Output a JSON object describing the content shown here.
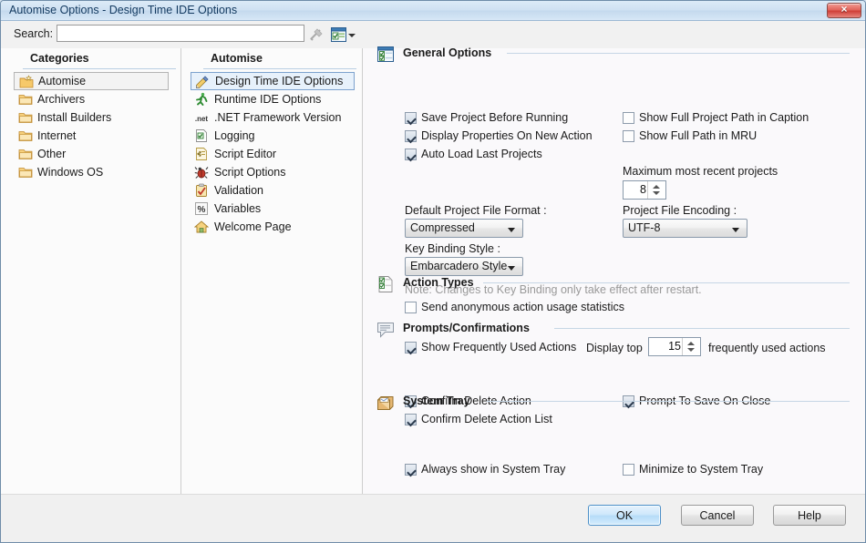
{
  "window": {
    "title": "Automise Options -  Design Time IDE Options",
    "close_label": "×",
    "accent_color": "#7da2ce",
    "titlebar_color": "#cfe1f2",
    "close_color": "#cf3f38"
  },
  "search": {
    "label": "Search:",
    "value": "",
    "placeholder": "",
    "clear_icon": "clear-search-icon",
    "options_icon": "search-options-icon",
    "dropdown_icon": "chevron-down-icon"
  },
  "categories": {
    "header": "Categories",
    "items": [
      {
        "label": "Automise",
        "icon": "folder-star-icon",
        "selected": true
      },
      {
        "label": "Archivers",
        "icon": "folder-icon",
        "selected": false
      },
      {
        "label": "Install Builders",
        "icon": "folder-icon",
        "selected": false
      },
      {
        "label": "Internet",
        "icon": "folder-icon",
        "selected": false
      },
      {
        "label": "Other",
        "icon": "folder-icon",
        "selected": false
      },
      {
        "label": "Windows OS",
        "icon": "folder-icon",
        "selected": false
      }
    ]
  },
  "pages": {
    "header": "Automise",
    "items": [
      {
        "label": "Design Time IDE Options",
        "icon": "pencil-ruler-icon",
        "selected": true
      },
      {
        "label": "Runtime IDE Options",
        "icon": "runner-icon",
        "selected": false
      },
      {
        "label": ".NET Framework Version",
        "icon": "dotnet-icon",
        "selected": false
      },
      {
        "label": "Logging",
        "icon": "log-document-icon",
        "selected": false
      },
      {
        "label": "Script Editor",
        "icon": "script-document-icon",
        "selected": false
      },
      {
        "label": "Script Options",
        "icon": "bug-icon",
        "selected": false
      },
      {
        "label": "Validation",
        "icon": "clipboard-check-icon",
        "selected": false
      },
      {
        "label": "Variables",
        "icon": "percent-icon",
        "selected": false
      },
      {
        "label": "Welcome Page",
        "icon": "home-icon",
        "selected": false
      }
    ]
  },
  "general_options": {
    "title": "General Options",
    "icon": "checklist-window-icon",
    "checkboxes_left": [
      {
        "label": "Save Project Before Running",
        "checked": true
      },
      {
        "label": "Display Properties On New Action",
        "checked": true
      },
      {
        "label": "Auto Load Last Projects",
        "checked": true
      }
    ],
    "checkboxes_right": [
      {
        "label": "Show Full Project Path in Caption",
        "checked": false
      },
      {
        "label": "Show Full Path in MRU",
        "checked": false
      }
    ],
    "max_recent_label": "Maximum most recent projects",
    "max_recent_value": "8",
    "default_format_label": "Default Project File Format :",
    "default_format_value": "Compressed",
    "encoding_label": "Project File Encoding :",
    "encoding_value": "UTF-8",
    "key_binding_label": "Key Binding Style :",
    "key_binding_value": "Embarcadero Style",
    "key_binding_note": "Note: Changes to Key Binding only take effect after restart.",
    "telemetry": {
      "label": "Send anonymous action usage statistics",
      "checked": false
    }
  },
  "action_types": {
    "title": "Action Types",
    "icon": "action-list-icon",
    "show_frequent": {
      "label": "Show Frequently Used Actions",
      "checked": true
    },
    "display_top_label": "Display top",
    "display_top_value": "15",
    "display_top_suffix": "frequently used actions"
  },
  "prompts": {
    "title": "Prompts/Confirmations",
    "icon": "speech-bubble-icon",
    "checkboxes_left": [
      {
        "label": "Confirm Delete Action",
        "checked": true
      },
      {
        "label": "Confirm Delete Action List",
        "checked": true
      }
    ],
    "checkboxes_right": [
      {
        "label": "Prompt To Save On Close",
        "checked": true
      }
    ]
  },
  "system_tray": {
    "title": "System Tray",
    "icon": "tray-inbox-icon",
    "checkboxes_left": [
      {
        "label": "Always show in System Tray",
        "checked": true
      }
    ],
    "checkboxes_right": [
      {
        "label": "Minimize to System Tray",
        "checked": false
      }
    ]
  },
  "footer": {
    "ok_label": "OK",
    "cancel_label": "Cancel",
    "help_label": "Help"
  }
}
